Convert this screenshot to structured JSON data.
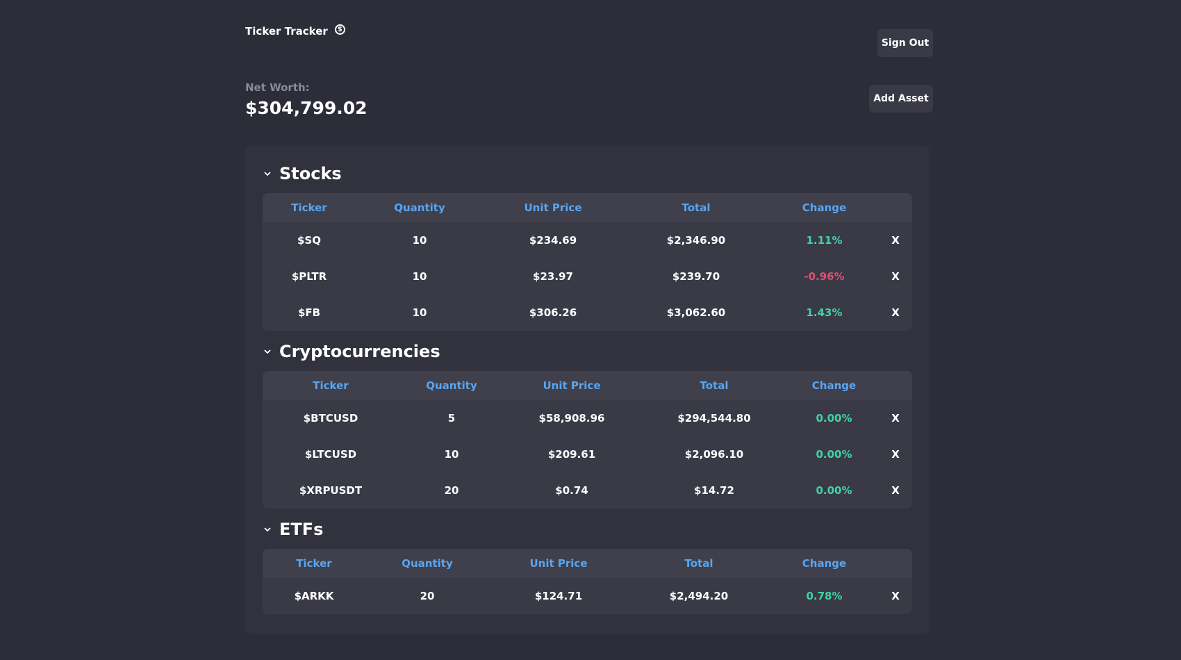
{
  "header": {
    "title": "Ticker Tracker",
    "coin_icon": "dollar-coin-icon",
    "signout_label": "Sign Out",
    "add_asset_label": "Add Asset"
  },
  "networth": {
    "label": "Net Worth:",
    "value": "$304,799.02"
  },
  "colors": {
    "background": "#2c2d38",
    "panel": "#31323d",
    "header_text": "#5aa5f0",
    "positive": "#42d3a6",
    "negative": "#e14f6e"
  },
  "columns": [
    "Ticker",
    "Quantity",
    "Unit Price",
    "Total",
    "Change"
  ],
  "delete_label": "X",
  "sections": [
    {
      "title": "Stocks",
      "rows": [
        {
          "ticker": "$SQ",
          "quantity": "10",
          "unit_price": "$234.69",
          "total": "$2,346.90",
          "change": "1.11%"
        },
        {
          "ticker": "$PLTR",
          "quantity": "10",
          "unit_price": "$23.97",
          "total": "$239.70",
          "change": "-0.96%"
        },
        {
          "ticker": "$FB",
          "quantity": "10",
          "unit_price": "$306.26",
          "total": "$3,062.60",
          "change": "1.43%"
        }
      ]
    },
    {
      "title": "Cryptocurrencies",
      "rows": [
        {
          "ticker": "$BTCUSD",
          "quantity": "5",
          "unit_price": "$58,908.96",
          "total": "$294,544.80",
          "change": "0.00%"
        },
        {
          "ticker": "$LTCUSD",
          "quantity": "10",
          "unit_price": "$209.61",
          "total": "$2,096.10",
          "change": "0.00%"
        },
        {
          "ticker": "$XRPUSDT",
          "quantity": "20",
          "unit_price": "$0.74",
          "total": "$14.72",
          "change": "0.00%"
        }
      ]
    },
    {
      "title": "ETFs",
      "rows": [
        {
          "ticker": "$ARKK",
          "quantity": "20",
          "unit_price": "$124.71",
          "total": "$2,494.20",
          "change": "0.78%"
        }
      ]
    }
  ]
}
